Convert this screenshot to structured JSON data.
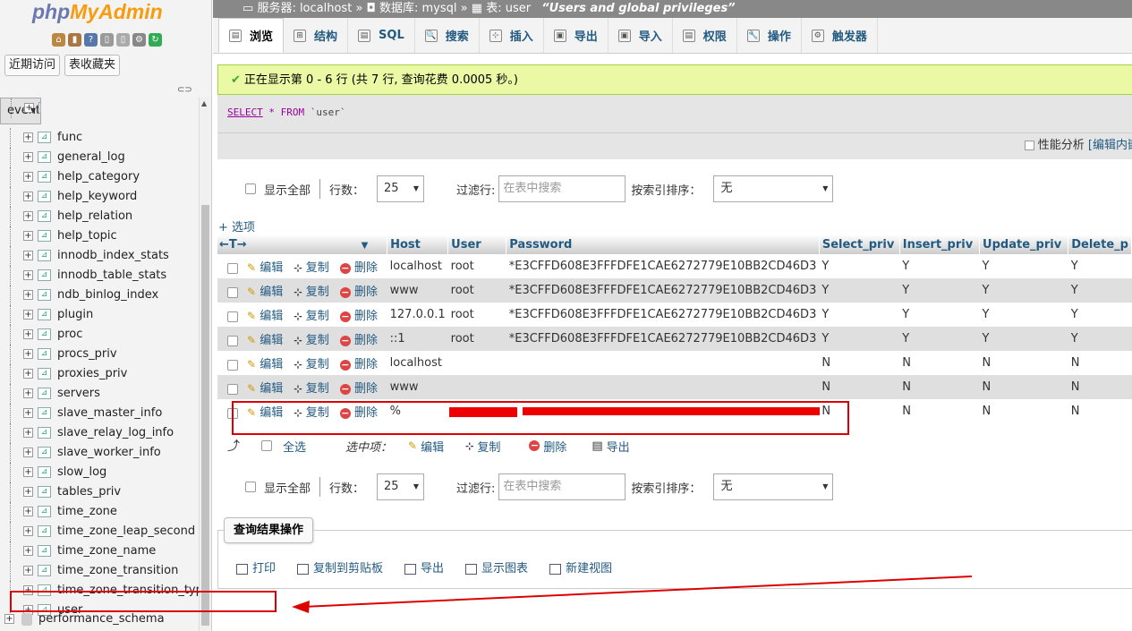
{
  "app": {
    "logo_php": "php",
    "logo_myadmin": "MyAdmin"
  },
  "left": {
    "buttons": [
      "近期访问",
      "表收藏夹"
    ],
    "tree": [
      "event",
      "func",
      "general_log",
      "help_category",
      "help_keyword",
      "help_relation",
      "help_topic",
      "innodb_index_stats",
      "innodb_table_stats",
      "ndb_binlog_index",
      "plugin",
      "proc",
      "procs_priv",
      "proxies_priv",
      "servers",
      "slave_master_info",
      "slave_relay_log_info",
      "slave_worker_info",
      "slow_log",
      "tables_priv",
      "time_zone",
      "time_zone_leap_second",
      "time_zone_name",
      "time_zone_transition",
      "time_zone_transition_type",
      "user"
    ],
    "schema": "performance_schema"
  },
  "breadcrumb": {
    "server": "服务器: localhost",
    "database": "数据库: mysql",
    "table": "表: user",
    "comment": "“Users and global privileges”",
    "sep": "»"
  },
  "tabs": [
    "浏览",
    "结构",
    "SQL",
    "搜索",
    "插入",
    "导出",
    "导入",
    "权限",
    "操作",
    "触发器"
  ],
  "tab_icons": [
    "▤",
    "⊞",
    "▤",
    "🔍",
    "⊹",
    "▣",
    "▣",
    "▤",
    "🔧",
    "⚙"
  ],
  "success_message": "正在显示第 0 - 6 行 (共 7 行, 查询花费 0.0005 秒。)",
  "sql": {
    "select": "SELECT",
    "star": "*",
    "from": "FROM",
    "table": "`user`"
  },
  "perf": {
    "label": "性能分析",
    "link": "[编辑内嵌"
  },
  "controls": {
    "show_all": "显示全部",
    "rows_label": "行数：",
    "rows_value": "25",
    "filter_label": "过滤行:",
    "filter_placeholder": "在表中搜索",
    "sort_label": "按索引排序：",
    "sort_value": "无"
  },
  "options_link": "+ 选项",
  "columns": [
    "Host",
    "User",
    "Password",
    "Select_priv",
    "Insert_priv",
    "Update_priv",
    "Delete_p"
  ],
  "actions": {
    "edit": "编辑",
    "copy": "复制",
    "delete": "删除"
  },
  "rows": [
    {
      "host": "localhost",
      "user": "root",
      "password": "*E3CFFD608E3FFFDFE1CAE6272779E10BB2CD46D3",
      "privs": [
        "Y",
        "Y",
        "Y",
        "Y"
      ]
    },
    {
      "host": "www",
      "user": "root",
      "password": "*E3CFFD608E3FFFDFE1CAE6272779E10BB2CD46D3",
      "privs": [
        "Y",
        "Y",
        "Y",
        "Y"
      ]
    },
    {
      "host": "127.0.0.1",
      "user": "root",
      "password": "*E3CFFD608E3FFFDFE1CAE6272779E10BB2CD46D3",
      "privs": [
        "Y",
        "Y",
        "Y",
        "Y"
      ]
    },
    {
      "host": "::1",
      "user": "root",
      "password": "*E3CFFD608E3FFFDFE1CAE6272779E10BB2CD46D3",
      "privs": [
        "Y",
        "Y",
        "Y",
        "Y"
      ]
    },
    {
      "host": "localhost",
      "user": "",
      "password": "",
      "privs": [
        "N",
        "N",
        "N",
        "N"
      ]
    },
    {
      "host": "www",
      "user": "",
      "password": "",
      "privs": [
        "N",
        "N",
        "N",
        "N"
      ]
    },
    {
      "host": "%",
      "user": "",
      "password": "",
      "privs": [
        "N",
        "N",
        "N",
        "N"
      ]
    }
  ],
  "bulk": {
    "select_all": "全选",
    "with_selected": "选中项：",
    "edit": "编辑",
    "copy": "复制",
    "delete": "删除",
    "export": "导出"
  },
  "query_ops": {
    "title": "查询结果操作",
    "items": [
      "打印",
      "复制到剪贴板",
      "导出",
      "显示图表",
      "新建视图"
    ]
  },
  "colors": {
    "link": "#235a81",
    "annotation_red": "#dd0000",
    "success_bg": "#ebf8a4"
  }
}
